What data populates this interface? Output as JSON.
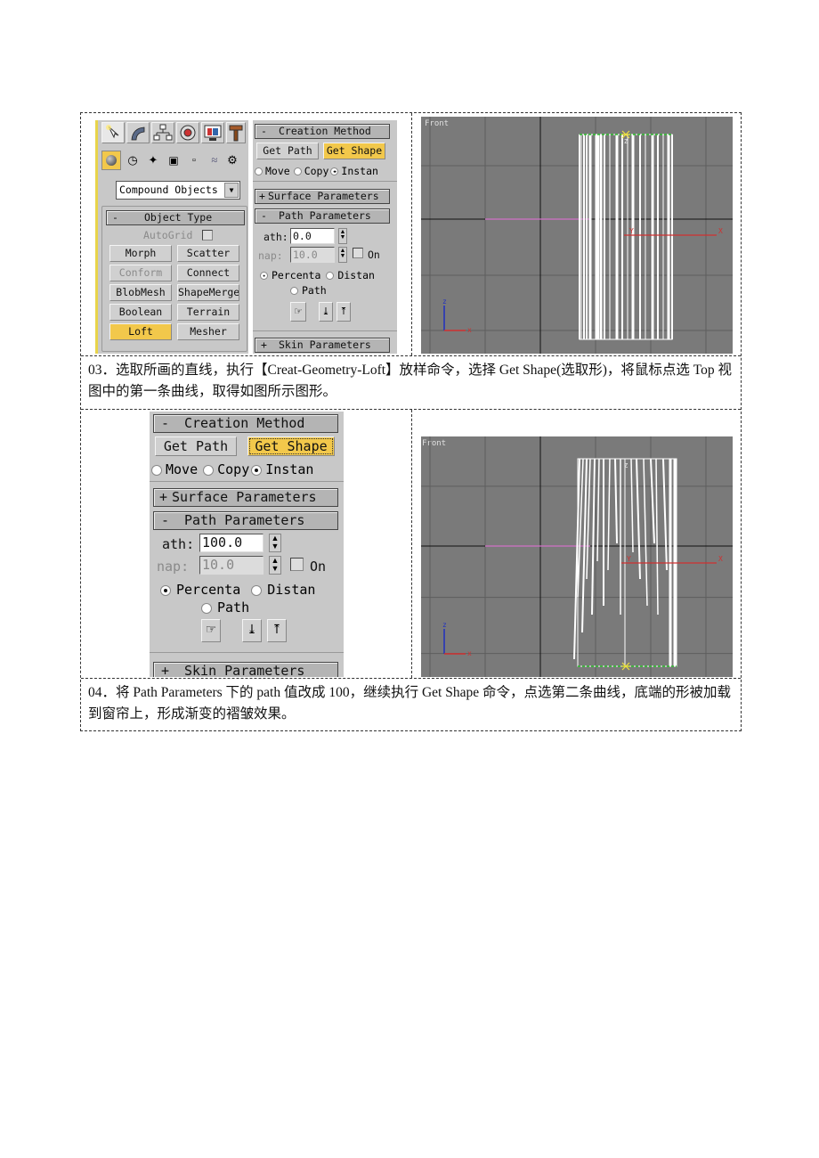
{
  "step1": {
    "command_panel": {
      "tab_icons": [
        "create-icon",
        "modify-icon",
        "hierarchy-icon",
        "motion-icon",
        "display-icon",
        "utilities-icon"
      ],
      "category_icons": [
        "geometry-icon",
        "shapes-icon",
        "lights-icon",
        "cameras-icon",
        "helpers-icon",
        "space-warps-icon",
        "systems-icon"
      ],
      "dropdown_value": "Compound Objects",
      "object_type": {
        "title": "Object Type",
        "collapse": "-",
        "autogrid_label": "AutoGrid",
        "buttons": [
          {
            "label": "Morph",
            "state": "normal"
          },
          {
            "label": "Scatter",
            "state": "normal"
          },
          {
            "label": "Conform",
            "state": "disabled"
          },
          {
            "label": "Connect",
            "state": "normal"
          },
          {
            "label": "BlobMesh",
            "state": "normal"
          },
          {
            "label": "ShapeMerge",
            "state": "normal"
          },
          {
            "label": "Boolean",
            "state": "normal"
          },
          {
            "label": "Terrain",
            "state": "normal"
          },
          {
            "label": "Loft",
            "state": "active"
          },
          {
            "label": "Mesher",
            "state": "normal"
          }
        ]
      }
    },
    "loft_panel": {
      "creation_method": {
        "title": "Creation Method",
        "collapse": "-",
        "get_path": "Get Path",
        "get_shape": "Get Shape"
      },
      "radios": [
        {
          "label": "Move",
          "checked": false
        },
        {
          "label": "Copy",
          "checked": false
        },
        {
          "label": "Instan",
          "checked": true
        }
      ],
      "surface_parameters": {
        "title": "Surface Parameters",
        "collapse": "+"
      },
      "path_parameters": {
        "title": "Path Parameters",
        "collapse": "-",
        "path_label": "ath:",
        "path_value": "0.0",
        "snap_label": "nap:",
        "snap_value": "10.0",
        "on_label": "On",
        "percent_label": "Percenta",
        "distance_label": "Distan",
        "path_steps_label": "Path",
        "unit_selected": "Percenta"
      },
      "skin_parameters": {
        "title": "Skin Parameters",
        "collapse": "+"
      }
    },
    "viewport": {
      "label": "Front",
      "gizmo_top_label": "Z",
      "axis_z": "z",
      "axis_x": "x",
      "axis_y": "Y",
      "pivot_label": "Y",
      "pivot_x_label": "X"
    },
    "caption": "03．选取所画的直线，执行【Creat-Geometry-Loft】放样命令，选择 Get Shape(选取形)，将鼠标点选 Top 视图中的第一条曲线，取得如图所示图形。"
  },
  "step2": {
    "loft_panel": {
      "creation_method": {
        "title": "Creation Method",
        "collapse": "-",
        "get_path": "Get Path",
        "get_shape": "Get Shape"
      },
      "radios": [
        {
          "label": "Move",
          "checked": false
        },
        {
          "label": "Copy",
          "checked": false
        },
        {
          "label": "Instan",
          "checked": true
        }
      ],
      "surface_parameters": {
        "title": "Surface Parameters",
        "collapse": "+"
      },
      "path_parameters": {
        "title": "Path Parameters",
        "collapse": "-",
        "path_label": "ath:",
        "path_value": "100.0",
        "snap_label": "nap:",
        "snap_value": "10.0",
        "on_label": "On",
        "percent_label": "Percenta",
        "distance_label": "Distan",
        "path_steps_label": "Path",
        "unit_selected": "Percenta"
      },
      "skin_parameters": {
        "title": "Skin Parameters",
        "collapse": "+"
      }
    },
    "viewport": {
      "label": "Front",
      "gizmo_top_label": "Z",
      "axis_z": "z",
      "axis_x": "x",
      "axis_y": "Y",
      "pivot_label": "Y",
      "pivot_x_label": "X"
    },
    "caption": "04．将 Path Parameters 下的 path 值改成 100，继续执行 Get Shape 命令，点选第二条曲线，底端的形被加载到窗帘上，形成渐变的褶皱效果。"
  },
  "colors": {
    "active_button": "#f2c84b",
    "viewport_bg": "#7a7a7a",
    "panel_bg": "#c8c8c8",
    "path_line": "#d070c8",
    "x_axis": "#d03030",
    "z_axis": "#2030c0",
    "shape_line": "#30c030"
  }
}
